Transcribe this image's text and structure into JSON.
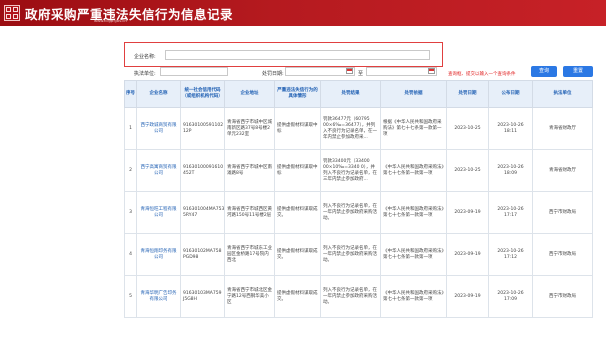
{
  "header": {
    "title": "政府采购严重违法失信行为信息记录",
    "url": "www.ccgp.gov.cn"
  },
  "search": {
    "company_label": "企业名称:",
    "company_value": "",
    "authority_label": "执法单位:",
    "date_label": "处罚日期:",
    "date_to": "至",
    "hint": "查询框、提交以输入一个查询条件",
    "query_button": "查询",
    "reset_button": "重置"
  },
  "table": {
    "headers": [
      "序号",
      "企业名称",
      "统一社会信用代码（或组织机构代码）",
      "企业地址",
      "严重违法失信行为的具体情形",
      "处罚结果",
      "处罚依据",
      "处罚日期",
      "公布日期",
      "执法单位"
    ],
    "rows": [
      {
        "index": "1",
        "company": "西宁政诚商贸有限公司",
        "code": "91630100591102 12P",
        "address": "青海省西宁市城中区城南新区路37号8号楼2单元232室",
        "situation": "提供虚假材料谋取中标",
        "result": "罚款36477元（60795 00×6‰=36477），并列入不良行为记录名单，在一年内禁止参加政府采...",
        "basis": "根据《中华人民共和国政府采购法》第七十七条第一款第一项",
        "penalty_date": "2023-10-25",
        "publish_date": "2023-10-26 18:11",
        "authority": "青海省财政厅"
      },
      {
        "index": "2",
        "company": "西宁高寓商贸有限公司",
        "code": "91630100091610 452T",
        "address": "青海省西宁市城中区南滩路8号",
        "situation": "提供虚假材料谋取中标",
        "result": "罚款33400元（33400 00×10‰=3340 0），并列入不良行为记录名单，在三年内禁止参加政府...",
        "basis": "《中华人民共和国政府采购法》第七十七条第一款第一项",
        "penalty_date": "2023-10-25",
        "publish_date": "2023-10-26 18:09",
        "authority": "青海省财政厅"
      },
      {
        "index": "3",
        "company": "青海恒旺工程有限公司",
        "code": "916301004MA753 5RY47",
        "address": "青海省西宁市城西区黄河路150号11号楼2层",
        "situation": "提供虚假材料谋取成交。",
        "result": "列入不良行为记录名单，在一年内禁止参加政府采购活动。",
        "basis": "《中华人民共和国政府采购法》第七十七条第一款第一项",
        "penalty_date": "2023-09-19",
        "publish_date": "2023-10-26 17:17",
        "authority": "西宁市财政局"
      },
      {
        "index": "4",
        "company": "青海恒翔印务有限公司",
        "code": "91630102MA758 PGD98",
        "address": "青海省西宁市城东工业园区金桥路17号院内西北",
        "situation": "提供虚假材料谋取成交。",
        "result": "列入不良行为记录名单，在一年内禁止参加政府采购活动。",
        "basis": "《中华人民共和国政府采购法》第七十七条第一款第一项",
        "penalty_date": "2023-09-19",
        "publish_date": "2023-10-26 17:12",
        "authority": "西宁市财政局"
      },
      {
        "index": "5",
        "company": "青海华明广告印务有限公司",
        "code": "91630103MA759 J5G8H",
        "address": "青海省西宁市城北区金宁路12号西钢华美小区",
        "situation": "提供虚假材料谋取成交。",
        "result": "列入不良行为记录名单，在一年内禁止参加政府采购活动。",
        "basis": "《中华人民共和国政府采购法》第七十七条第一款第一项",
        "penalty_date": "2023-09-19",
        "publish_date": "2023-10-26 17:09",
        "authority": "西宁市财政局"
      }
    ]
  }
}
